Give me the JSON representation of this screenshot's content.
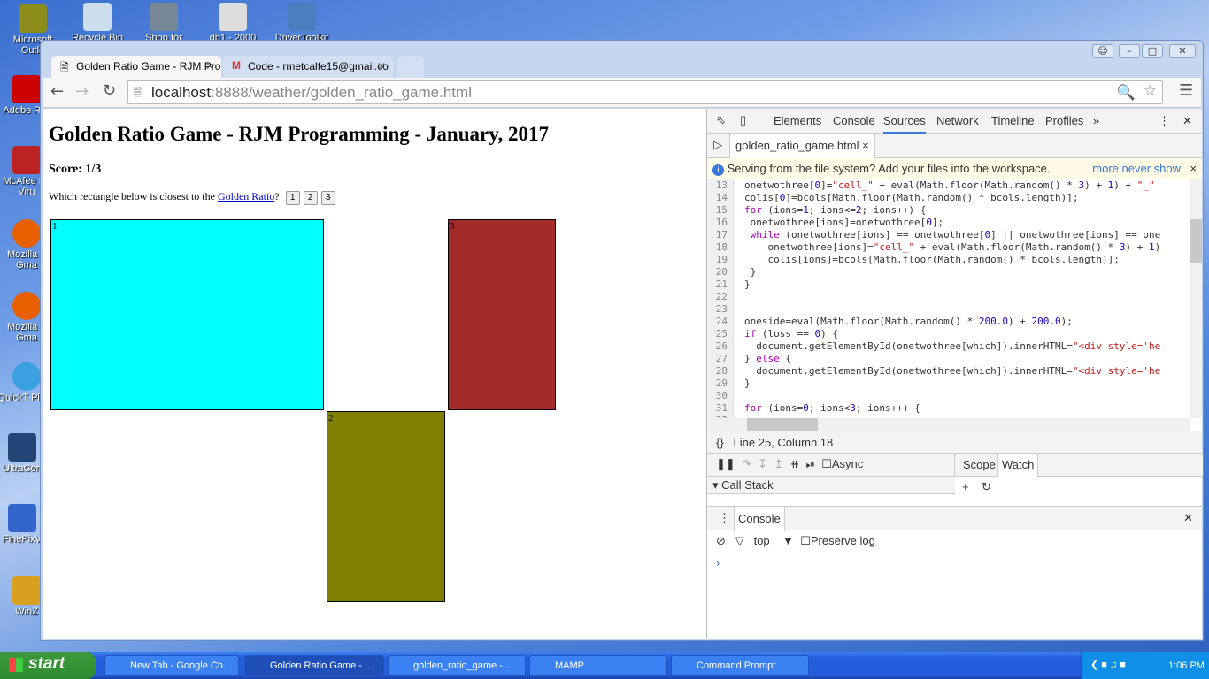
{
  "desktop": {
    "icons_left": [
      "Microsoft Outlo",
      "Adobe R X",
      "McAfee for Viru",
      "Mozilla F Gma",
      "Mozilla F Gma",
      "QuickT Playe",
      "UltraCon",
      "FinePixV",
      "WinZ"
    ],
    "icons_top": [
      "Recycle Bin",
      "Shop for",
      "db1 - 2000",
      "DriverToolkit"
    ]
  },
  "browser": {
    "tabs": [
      {
        "label": "Golden Ratio Game - RJM Pro",
        "active": true
      },
      {
        "label": "Code - rmetcalfe15@gmail.co",
        "active": false
      }
    ],
    "url_host": "localhost",
    "url_rest": ":8888/weather/golden_ratio_game.html"
  },
  "page": {
    "title": "Golden Ratio Game - RJM Programming - January, 2017",
    "score": "Score: 1/3",
    "question": "Which rectangle below is closest to the ",
    "link": "Golden Ratio",
    "question_end": "?",
    "buttons": [
      "1",
      "2",
      "3"
    ],
    "rects": [
      {
        "label": "1",
        "color": "#00ffff"
      },
      {
        "label": "2",
        "color": "#808000"
      },
      {
        "label": "3",
        "color": "#a52a2a"
      }
    ]
  },
  "devtools": {
    "tabs": [
      "Elements",
      "Console",
      "Sources",
      "Network",
      "Timeline",
      "Profiles"
    ],
    "active_tab": "Sources",
    "file_tab": "golden_ratio_game.html",
    "info": "Serving from the file system? Add your files into the workspace.",
    "info_more": "more",
    "info_never": "never show",
    "code_start": 13,
    "code": [
      "onetwothree[0]=\"cell_\" + eval(Math.floor(Math.random() * 3) + 1) + \"_\"",
      "colis[0]=bcols[Math.floor(Math.random() * bcols.length)];",
      "for (ions=1; ions<=2; ions++) {",
      " onetwothree[ions]=onetwothree[0];",
      " while (onetwothree[ions] == onetwothree[0] || onetwothree[ions] == one",
      "    onetwothree[ions]=\"cell_\" + eval(Math.floor(Math.random() * 3) + 1)",
      "    colis[ions]=bcols[Math.floor(Math.random() * bcols.length)];",
      " }",
      "}",
      "",
      "",
      "oneside=eval(Math.floor(Math.random() * 200.0) + 200.0);",
      "if (loss == 0) {",
      "  document.getElementById(onetwothree[which]).innerHTML=\"<div style='he",
      "} else {",
      "  document.getElementById(onetwothree[which]).innerHTML=\"<div style='he",
      "}",
      "",
      "for (ions=0; ions<3; ions++) {",
      ""
    ],
    "position": "Line 25, Column 18",
    "async": "Async",
    "scope": "Scope",
    "watch": "Watch",
    "call_stack": "Call Stack",
    "console_tab": "Console",
    "context": "top",
    "preserve_log": "Preserve log"
  },
  "taskbar": {
    "start": "start",
    "items": [
      {
        "label": "New Tab - Google Ch...",
        "active": false
      },
      {
        "label": "Golden Ratio Game - ...",
        "active": true
      },
      {
        "label": "golden_ratio_game - ...",
        "active": false
      },
      {
        "label": "MAMP",
        "active": false
      },
      {
        "label": "Command Prompt",
        "active": false
      }
    ],
    "clock": "1:06 PM"
  }
}
